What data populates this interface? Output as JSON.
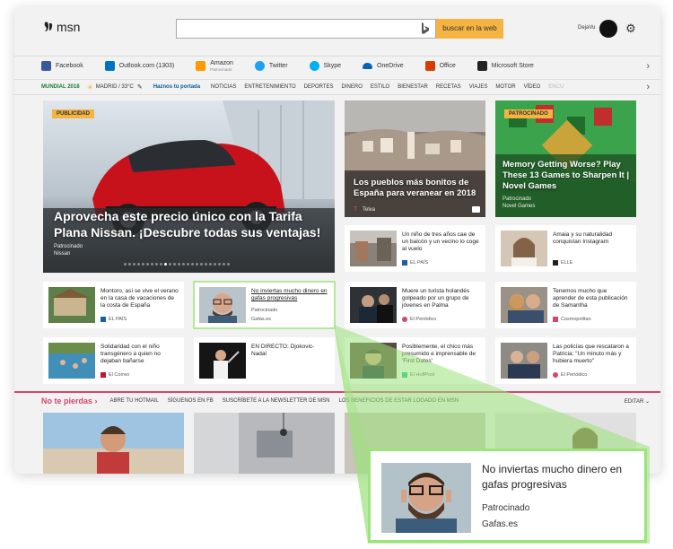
{
  "header": {
    "logo_text": "msn",
    "search_button": "buscar en la web",
    "user_name": "DejaVu"
  },
  "shortcuts": [
    {
      "label": "Facebook",
      "icon": "facebook-icon",
      "color": "#3b5998"
    },
    {
      "label": "Outlook.com (1303)",
      "icon": "outlook-icon",
      "color": "#0072c6"
    },
    {
      "label": "Amazon",
      "sub": "Patrocinado",
      "icon": "amazon-icon",
      "color": "#ff9900"
    },
    {
      "label": "Twitter",
      "icon": "twitter-icon",
      "color": "#1da1f2"
    },
    {
      "label": "Skype",
      "icon": "skype-icon",
      "color": "#00aff0"
    },
    {
      "label": "OneDrive",
      "icon": "onedrive-icon",
      "color": "#0364b8"
    },
    {
      "label": "Office",
      "icon": "office-icon",
      "color": "#d83b01"
    },
    {
      "label": "Microsoft Store",
      "icon": "store-icon",
      "color": "#222222"
    }
  ],
  "nav": {
    "mundial": "MUNDIAL 2018",
    "weather": "MADRID / 33°C",
    "home_link": "Haznos tu portada",
    "items": [
      "NOTICIAS",
      "ENTRETENIMIENTO",
      "DEPORTES",
      "DINERO",
      "ESTILO",
      "BIENESTAR",
      "RECETAS",
      "VIAJES",
      "MOTOR",
      "VÍDEO"
    ],
    "faded": "ENCU"
  },
  "hero": {
    "tag": "PUBLICIDAD",
    "title": "Aprovecha este precio único con la Tarifa Plana Nissan. ¡Descubre todas sus ventajas!",
    "sponsored": "Patrocinado",
    "source": "Nissan"
  },
  "card_pueblos": {
    "title": "Los pueblos más bonitos de España para veranear en 2018",
    "source": "Telva"
  },
  "card_memory": {
    "tag": "PATROCINADO",
    "title": "Memory Getting Worse? Play These 13 Games to Sharpen It | Novel Games",
    "sponsored": "Patrocinado",
    "source": "Novel Games"
  },
  "small_cards": [
    {
      "text": "Un niño de tres años cae de un balcón y un vecino lo coge al vuelo",
      "source": "EL PAÍS"
    },
    {
      "text": "Amaia y su naturalidad conquistan Instagram",
      "source": "ELLE"
    },
    {
      "text": "Montoro, así se vive el verano en la casa de vacaciones de la costa de España",
      "source": "EL PAÍS"
    },
    {
      "text": "No inviertas mucho dinero en gafas progresivas",
      "sponsored": "Patrocinado",
      "source": "Gafas.es"
    },
    {
      "text": "Muere un turista holandés golpeado por un grupo de jóvenes en Palma",
      "source": "El Periódico"
    },
    {
      "text": "Tenemos mucho que aprender de esta publicación de Samantha",
      "source": "Cosmopolitan"
    },
    {
      "text": "Solidaridad con el niño transgénero a quien no dejaban bañarse",
      "source": "El Correo"
    },
    {
      "text": "EN DIRECTO: Djokovic-Nadal",
      "source": ""
    },
    {
      "text": "Posiblemente, el chico más presumido e imprensable de 'First Dates'",
      "source": "El HuffPost"
    },
    {
      "text": "Las policías que rescataron a Patricia: \"Un minuto más y hubiera muerto\"",
      "source": "El Periódico"
    }
  ],
  "section": {
    "title": "No te pierdas",
    "items": [
      "ABRE TU HOTMAIL",
      "SÍGUENOS EN FB",
      "SUSCRÍBETE A LA NEWSLETTER DE MSN",
      "LOS BENEFICIOS DE ESTAR LOGADO EN MSN"
    ],
    "edit": "EDITAR"
  },
  "callout": {
    "title": "No inviertas mucho dinero en gafas progresivas",
    "sponsored": "Patrocinado",
    "source": "Gafas.es"
  },
  "colors": {
    "accent": "#f5b342",
    "section": "#d4466b",
    "highlight": "#9be37a"
  }
}
